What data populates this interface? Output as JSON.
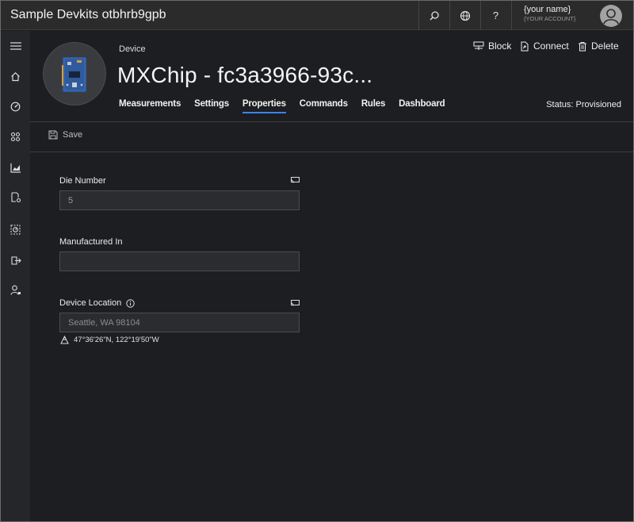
{
  "app": {
    "title": "Sample Devkits otbhrb9gpb"
  },
  "topbar": {
    "search_icon": "search-icon",
    "globe_icon": "globe-icon",
    "help_label": "?",
    "user_name": "{your name}",
    "user_account": "{YOUR ACCOUNT}"
  },
  "nav": {
    "items": [
      "menu-icon",
      "home-icon",
      "dashboard-gauge-icon",
      "apps-grid-icon",
      "analytics-chart-icon",
      "device-settings-icon",
      "jobs-icon",
      "export-icon",
      "admin-user-icon"
    ]
  },
  "device": {
    "label": "Device",
    "title": "MXChip - fc3a3966-93c...",
    "status": "Status: Provisioned"
  },
  "actions": {
    "block": "Block",
    "connect": "Connect",
    "delete": "Delete"
  },
  "tabs": [
    {
      "label": "Measurements",
      "active": false
    },
    {
      "label": "Settings",
      "active": false
    },
    {
      "label": "Properties",
      "active": true
    },
    {
      "label": "Commands",
      "active": false
    },
    {
      "label": "Rules",
      "active": false
    },
    {
      "label": "Dashboard",
      "active": false
    }
  ],
  "toolbar": {
    "save_label": "Save"
  },
  "form": {
    "die_number": {
      "label": "Die Number",
      "value": "5"
    },
    "manufactured_in": {
      "label": "Manufactured In",
      "value": ""
    },
    "device_location": {
      "label": "Device Location",
      "placeholder": "Seattle, WA 98104",
      "coordinates": "47°36'26\"N, 122°19'50\"W"
    }
  },
  "colors": {
    "accent": "#3b82f6",
    "background": "#1c1e21",
    "topbar": "#2b2b2b"
  }
}
